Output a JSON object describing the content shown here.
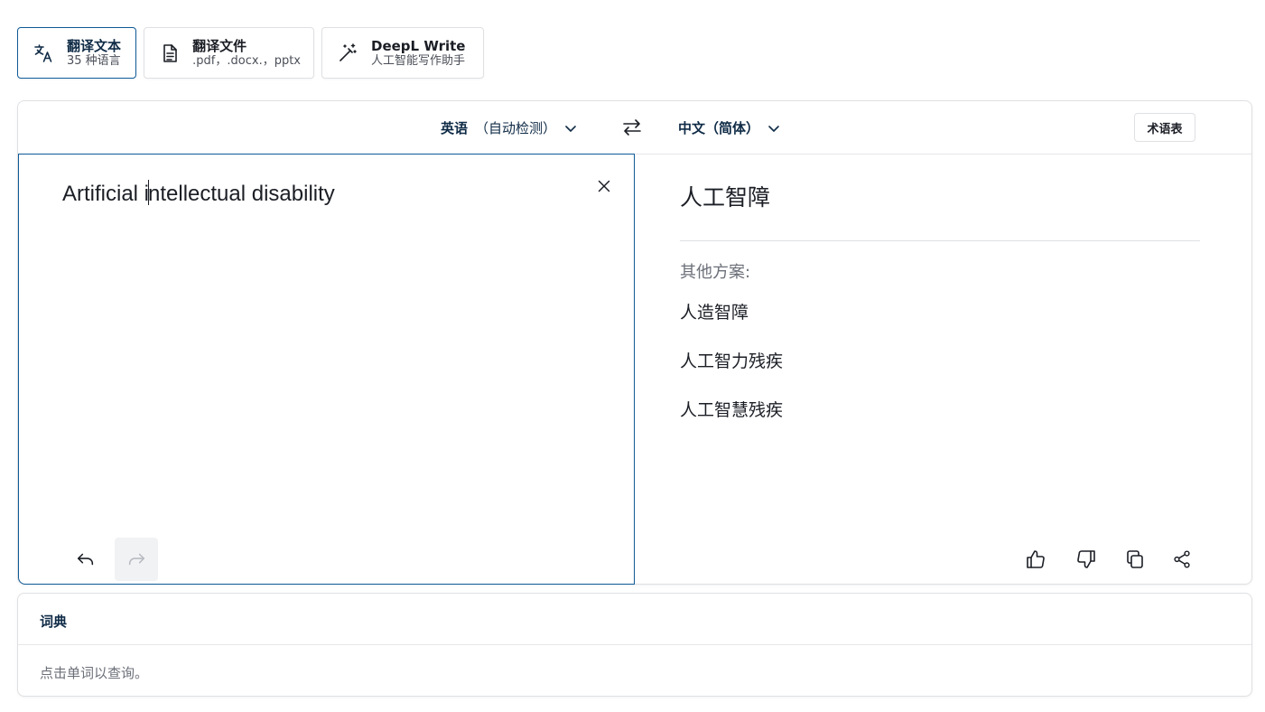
{
  "tabs": [
    {
      "title": "翻译文本",
      "subtitle": "35 种语言",
      "icon": "translate-icon",
      "active": true
    },
    {
      "title": "翻译文件",
      "subtitle": ".pdf，.docx.，pptx",
      "icon": "document-icon",
      "active": false
    },
    {
      "title": "DeepL Write",
      "subtitle": "人工智能写作助手",
      "icon": "magic-wand-icon",
      "active": false
    }
  ],
  "language_bar": {
    "source_language": "英语",
    "source_auto": "（自动检测）",
    "target_language": "中文（简体）",
    "glossary_label": "术语表"
  },
  "source": {
    "text_before_caret": "Artificial i",
    "text_after_caret": "ntellectual disability"
  },
  "target": {
    "translation": "人工智障",
    "alternatives_label": "其他方案:",
    "alternatives": [
      "人造智障",
      "人工智力残疾",
      "人工智慧残疾"
    ]
  },
  "dictionary": {
    "title": "词典",
    "hint": "点击单词以查询。"
  },
  "colors": {
    "accent": "#0f2b46",
    "active_border": "#0f5a96",
    "border": "#dfe0e3"
  }
}
